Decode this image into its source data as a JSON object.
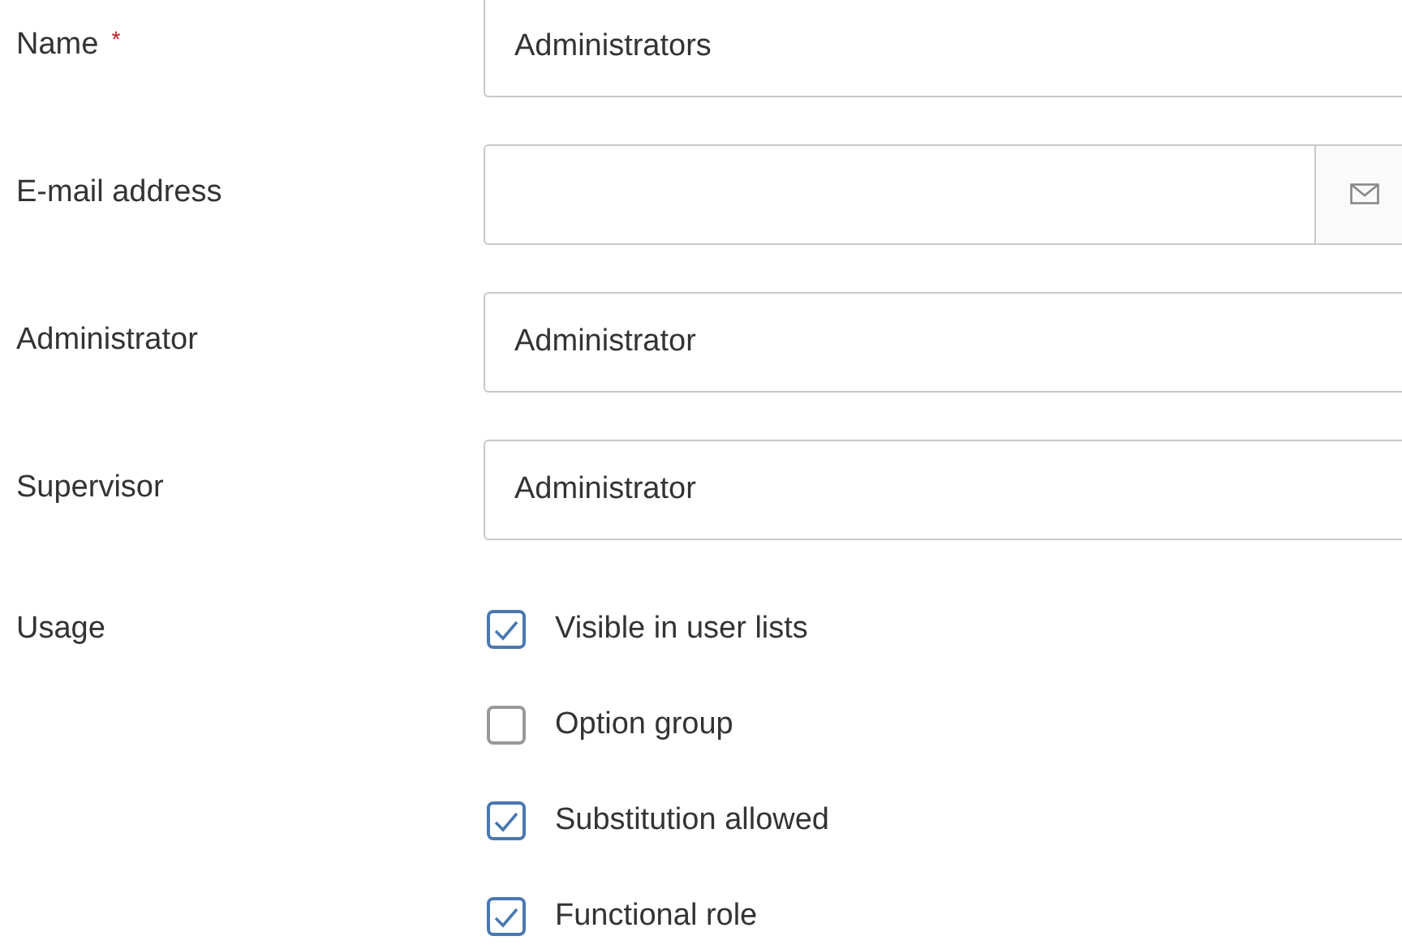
{
  "fields": [
    {
      "kind": "text",
      "label": "Name",
      "required": true,
      "value": "Administrators"
    },
    {
      "kind": "email",
      "label": "E-mail address",
      "required": false
    },
    {
      "kind": "text",
      "label": "Administrator",
      "required": false,
      "value": "Administrator"
    },
    {
      "kind": "text",
      "label": "Supervisor",
      "required": false,
      "value": "Administrator"
    }
  ],
  "required_mark": "*",
  "usage": {
    "label": "Usage",
    "options": [
      {
        "label": "Visible in user lists",
        "checked": true
      },
      {
        "label": "Option group",
        "checked": false
      },
      {
        "label": "Substitution allowed",
        "checked": true
      },
      {
        "label": "Functional role",
        "checked": true
      }
    ]
  }
}
